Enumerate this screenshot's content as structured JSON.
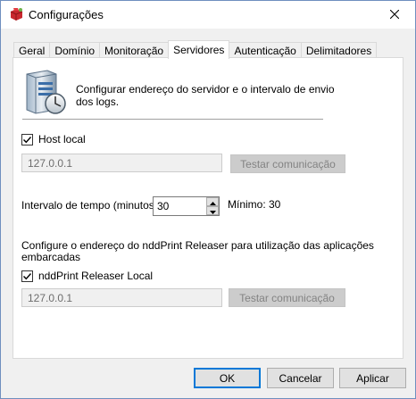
{
  "window": {
    "title": "Configurações",
    "app_icon": "red-box-icon",
    "close_icon": "close-icon"
  },
  "tabs": [
    {
      "label": "Geral",
      "active": false
    },
    {
      "label": "Domínio",
      "active": false
    },
    {
      "label": "Monitoração",
      "active": false
    },
    {
      "label": "Servidores",
      "active": true
    },
    {
      "label": "Autenticação",
      "active": false
    },
    {
      "label": "Delimitadores",
      "active": false
    }
  ],
  "servers": {
    "icon": "server-clock-icon",
    "description": "Configurar endereço do servidor e o intervalo de envio dos logs.",
    "host_local": {
      "label": "Host local",
      "checked": true
    },
    "host_address": {
      "value": "127.0.0.1",
      "disabled": true
    },
    "test_button_1": {
      "label": "Testar comunicação",
      "disabled": true
    },
    "interval": {
      "label": "Intervalo de tempo (minutos):",
      "value": "30",
      "minimum": "Mínimo: 30"
    },
    "releaser_desc": "Configure o endereço do nddPrint Releaser para utilização das aplicações embarcadas",
    "releaser_local": {
      "label": "nddPrint Releaser Local",
      "checked": true
    },
    "releaser_address": {
      "value": "127.0.0.1",
      "disabled": true
    },
    "test_button_2": {
      "label": "Testar comunicação",
      "disabled": true
    }
  },
  "buttons": {
    "ok": "OK",
    "cancel": "Cancelar",
    "apply": "Aplicar"
  },
  "colors": {
    "accent": "#0078d7",
    "tab_border": "#d9d9d9",
    "disabled_bg": "#cccccc"
  }
}
